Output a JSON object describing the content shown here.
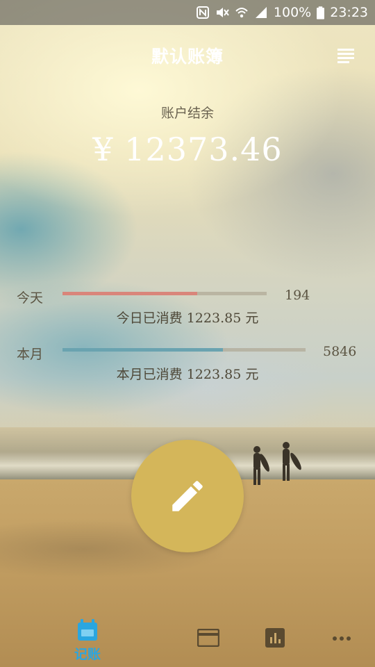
{
  "status_bar": {
    "battery_percent": "100%",
    "time": "23:23",
    "icons": [
      "nfc-icon",
      "mute-icon",
      "wifi-icon",
      "signal-icon",
      "battery-icon"
    ]
  },
  "header": {
    "title": "默认账簿",
    "menu_icon": "menu-icon"
  },
  "balance": {
    "label": "账户结余",
    "value": "¥ 12373.46"
  },
  "today": {
    "label": "今天",
    "count": "194",
    "progress": 0.66,
    "bar_color": "#d9857a",
    "spent_text": "今日已消费 1223.85 元"
  },
  "month": {
    "label": "本月",
    "count": "5846",
    "progress": 0.66,
    "bar_color": "#6aa3b0",
    "spent_text": "本月已消费 1223.85 元"
  },
  "fab": {
    "icon": "pencil-icon",
    "color": "#d4b65a"
  },
  "bottom_nav": {
    "items": [
      {
        "icon": "calendar-icon",
        "label": "记账",
        "active": true
      },
      {
        "icon": "card-icon",
        "label": "",
        "active": false
      },
      {
        "icon": "bar-chart-icon",
        "label": "",
        "active": false
      },
      {
        "icon": "more-icon",
        "label": "",
        "active": false
      }
    ],
    "active_color": "#2aa6e0"
  }
}
